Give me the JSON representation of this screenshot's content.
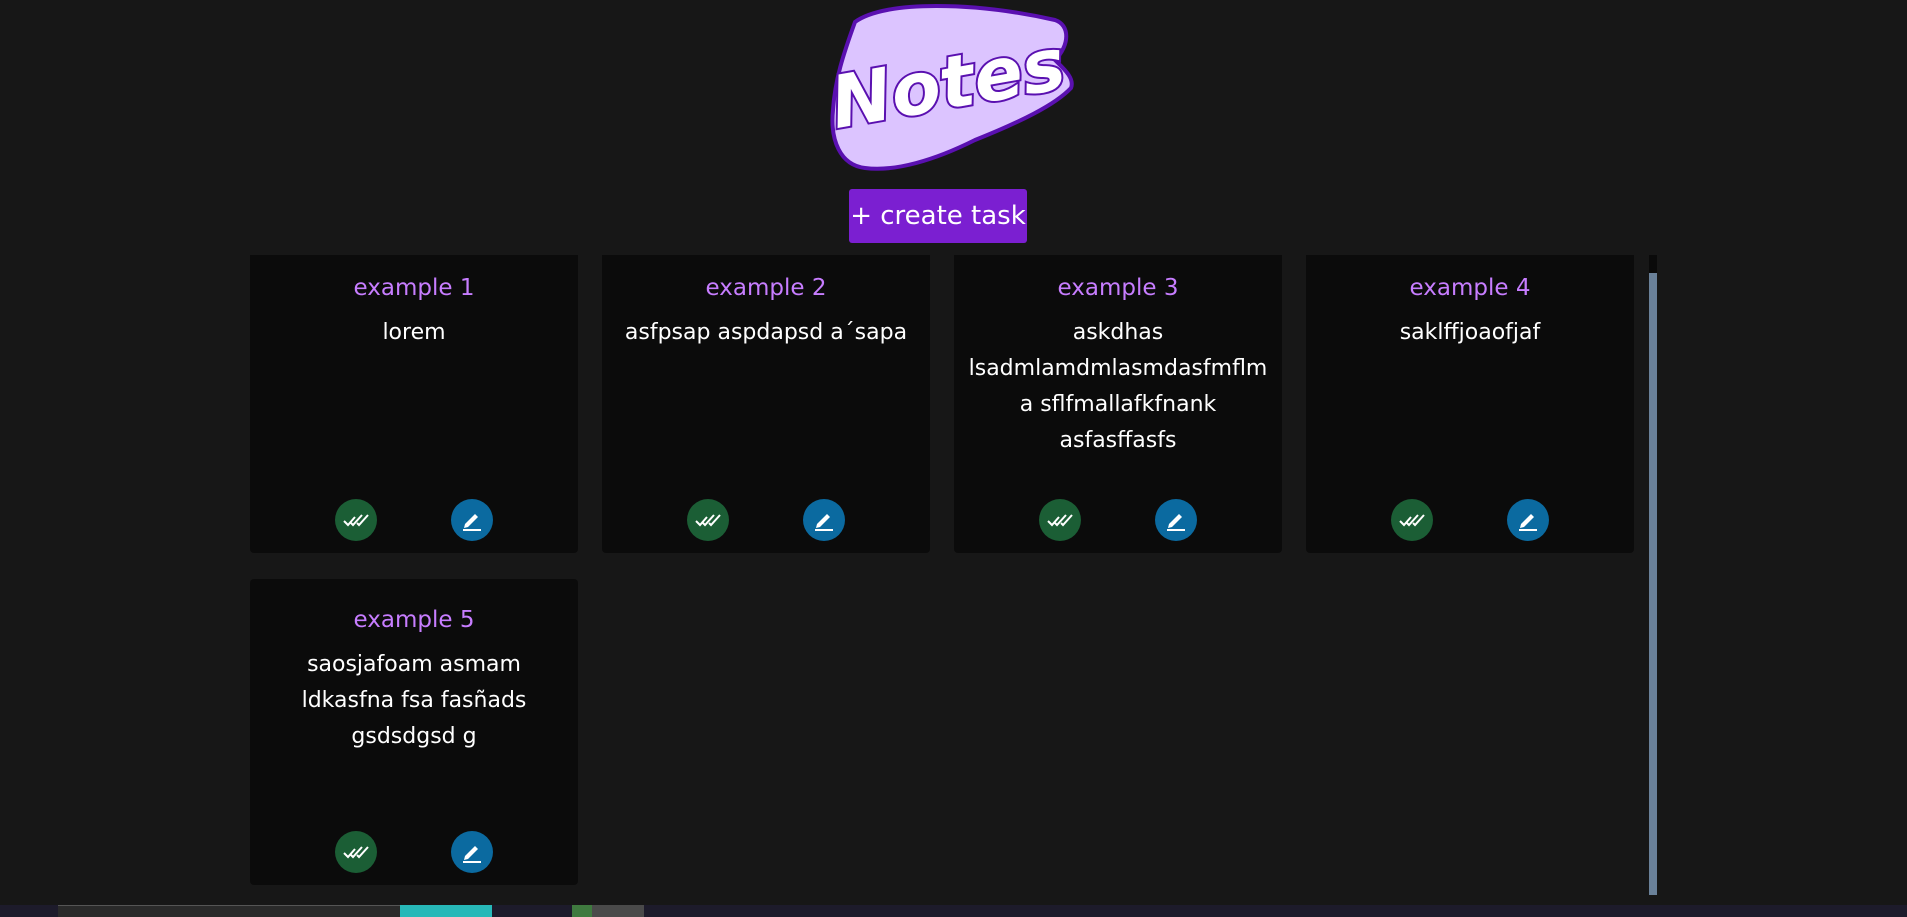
{
  "app": {
    "logo_text": "Notes",
    "create_button_label": "+ create task"
  },
  "colors": {
    "background": "#171717",
    "card_background": "#0b0b0b",
    "title_color": "#c77dff",
    "accent": "#7b1fd1",
    "done_button": "#1b5e35",
    "edit_button": "#0b6aa0",
    "logo_fill": "#dcc4ff",
    "logo_stroke": "#5a10b0"
  },
  "icons": {
    "done": "double-check-icon",
    "edit": "pencil-icon"
  },
  "notes": [
    {
      "title": "example 1",
      "body": "lorem"
    },
    {
      "title": "example 2",
      "body": "asfpsap aspdapsd a´sapa"
    },
    {
      "title": "example 3",
      "body": "askdhas lsadmlamdmlasmdasfmflma sflfmallafkfnank asfasffasfs"
    },
    {
      "title": "example 4",
      "body": "saklffjoaofjaf"
    },
    {
      "title": "example 5",
      "body": "saosjafoam asmam ldkasfna fsa fasñads gsdsdgsd g"
    }
  ]
}
